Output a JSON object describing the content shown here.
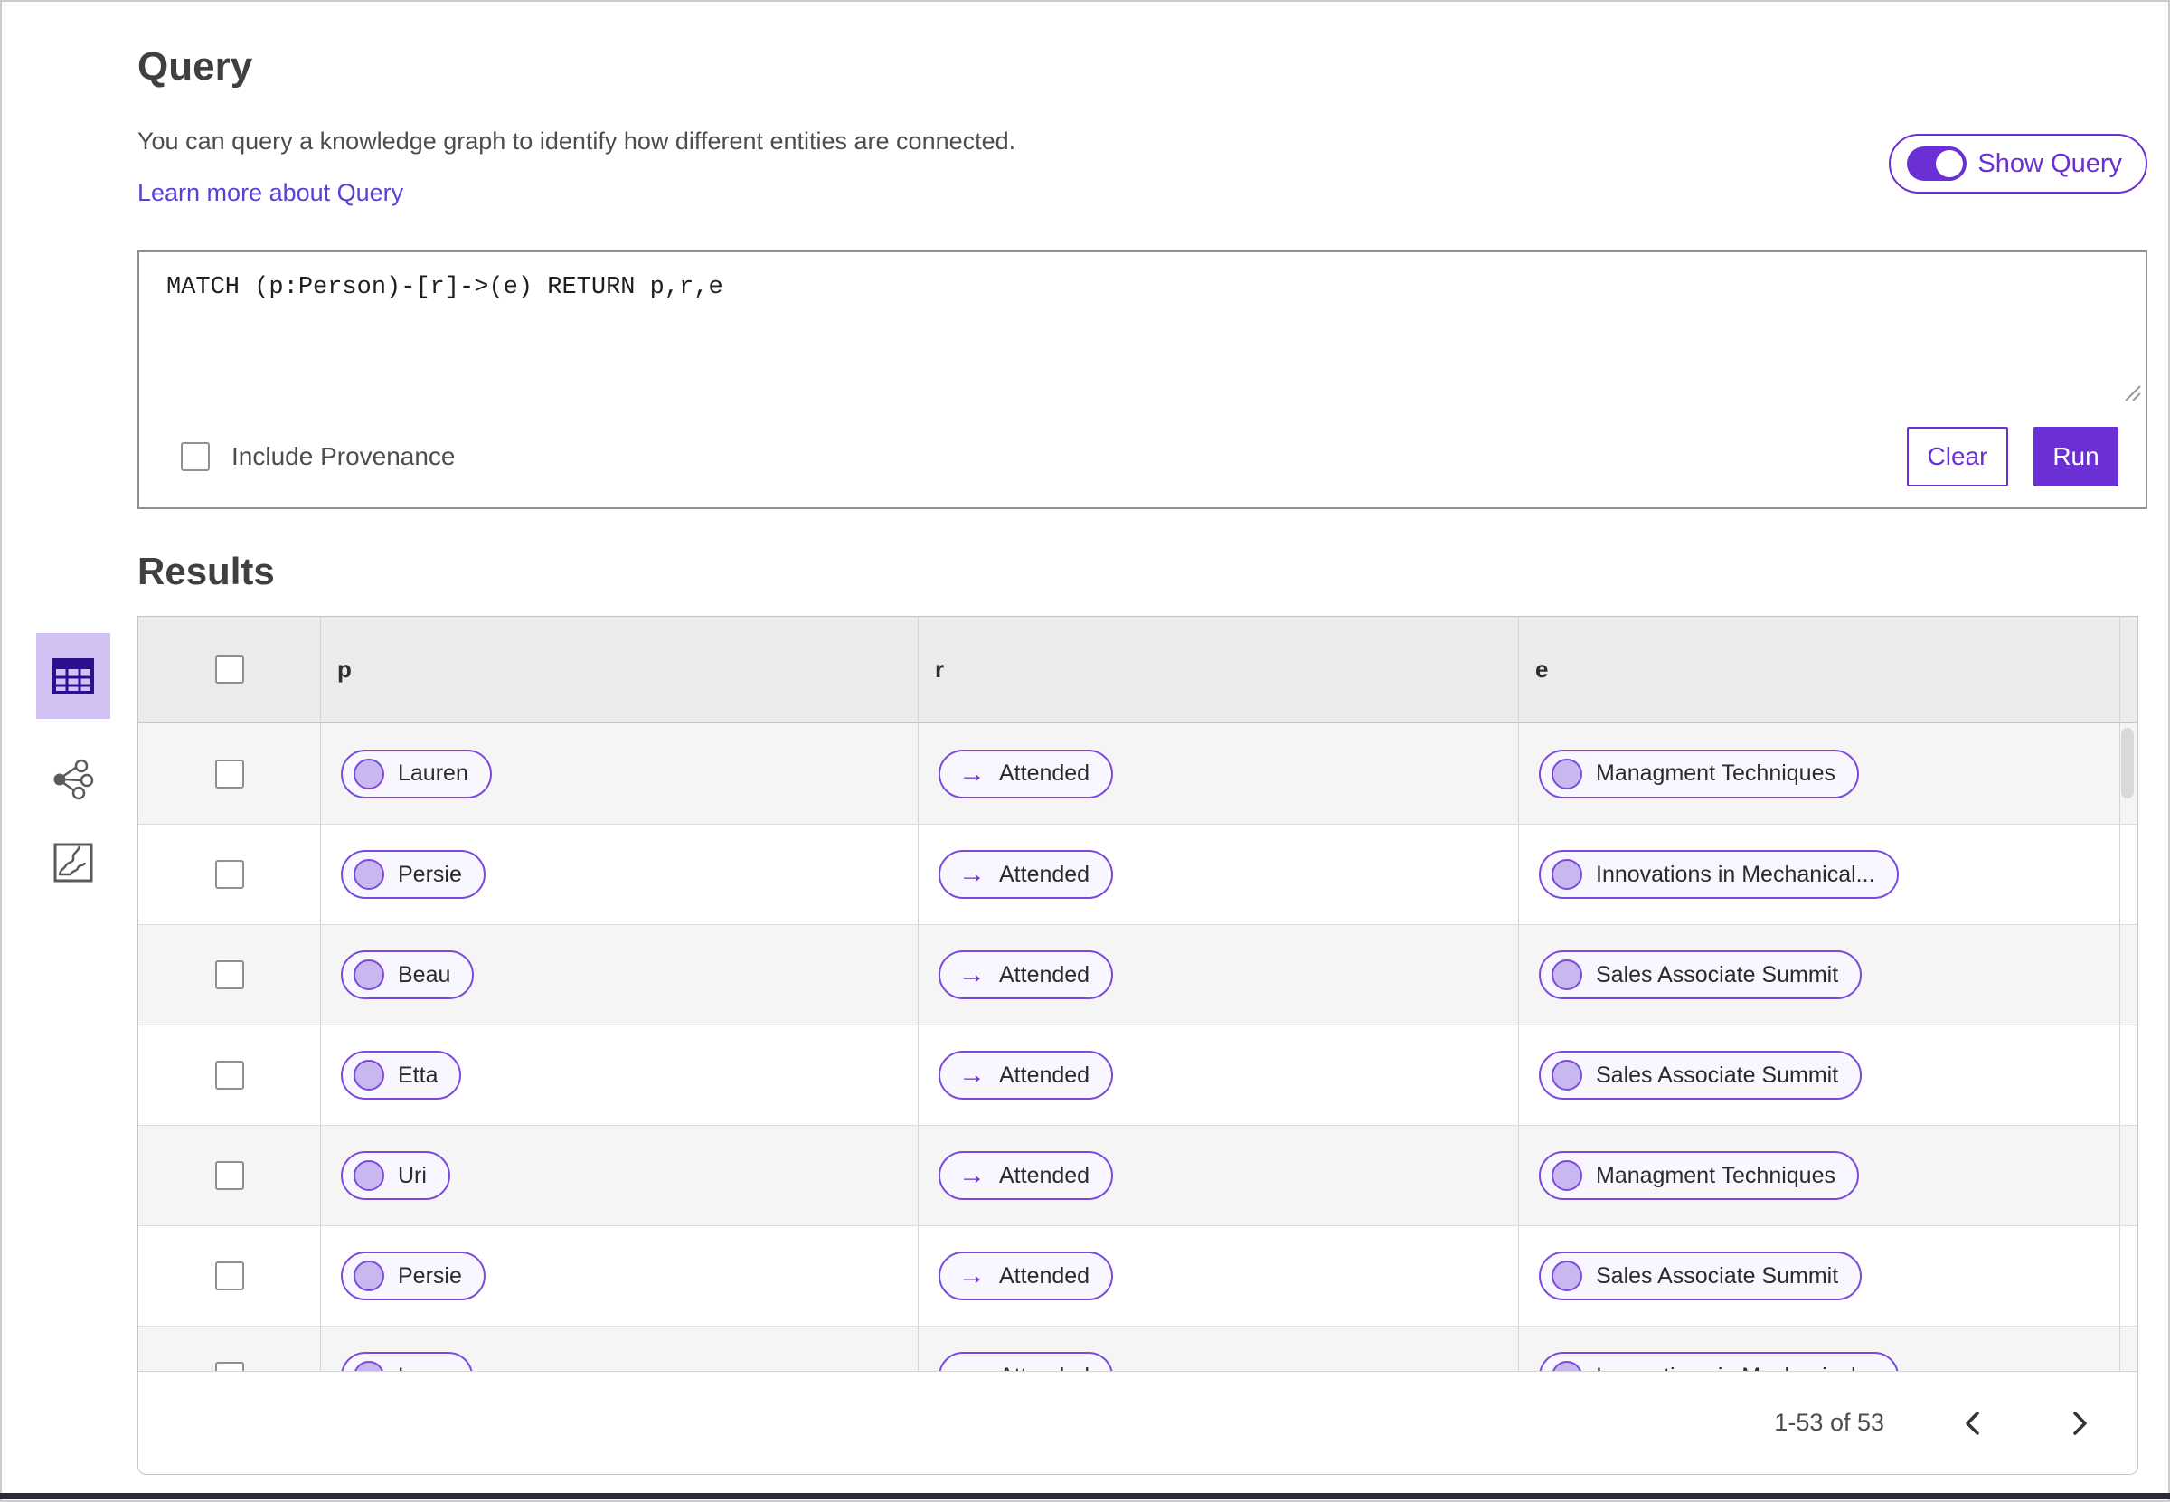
{
  "header": {
    "title": "Query",
    "description": "You can query a knowledge graph to identify how different entities are connected.",
    "learn_more_label": "Learn more about Query",
    "show_query_label": "Show Query",
    "show_query_on": true
  },
  "query_editor": {
    "text": "MATCH (p:Person)-[r]->(e) RETURN p,r,e",
    "include_provenance_label": "Include Provenance",
    "include_provenance_checked": false,
    "clear_label": "Clear",
    "run_label": "Run"
  },
  "results": {
    "title": "Results",
    "columns": [
      "p",
      "r",
      "e"
    ],
    "rows": [
      {
        "p": "Lauren",
        "r": "Attended",
        "e": "Managment Techniques"
      },
      {
        "p": "Persie",
        "r": "Attended",
        "e": "Innovations in Mechanical..."
      },
      {
        "p": "Beau",
        "r": "Attended",
        "e": "Sales Associate Summit"
      },
      {
        "p": "Etta",
        "r": "Attended",
        "e": "Sales Associate Summit"
      },
      {
        "p": "Uri",
        "r": "Attended",
        "e": "Managment Techniques"
      },
      {
        "p": "Persie",
        "r": "Attended",
        "e": "Sales Associate Summit"
      },
      {
        "p": "Larry",
        "r": "Attended",
        "e": "Innovations in Mechanical..."
      }
    ],
    "views": [
      {
        "icon": "table-view-icon",
        "selected": true
      },
      {
        "icon": "network-view-icon",
        "selected": false
      },
      {
        "icon": "map-view-icon",
        "selected": false
      }
    ],
    "pagination": {
      "range_label": "1-53 of 53"
    }
  },
  "icons": {
    "relation_arrow": "→"
  },
  "colors": {
    "accent": "#6b30d5",
    "pill_border": "#7a4bdb",
    "pill_background": "#f8f6fe",
    "pill_dot": "#c9b8ef",
    "selected_view_background": "#d2c2f3",
    "selected_view_icon": "#2f0e8e",
    "table_header_background": "#ebebeb",
    "striped_row_background": "#f5f5f5",
    "link": "#5b3fd6"
  }
}
